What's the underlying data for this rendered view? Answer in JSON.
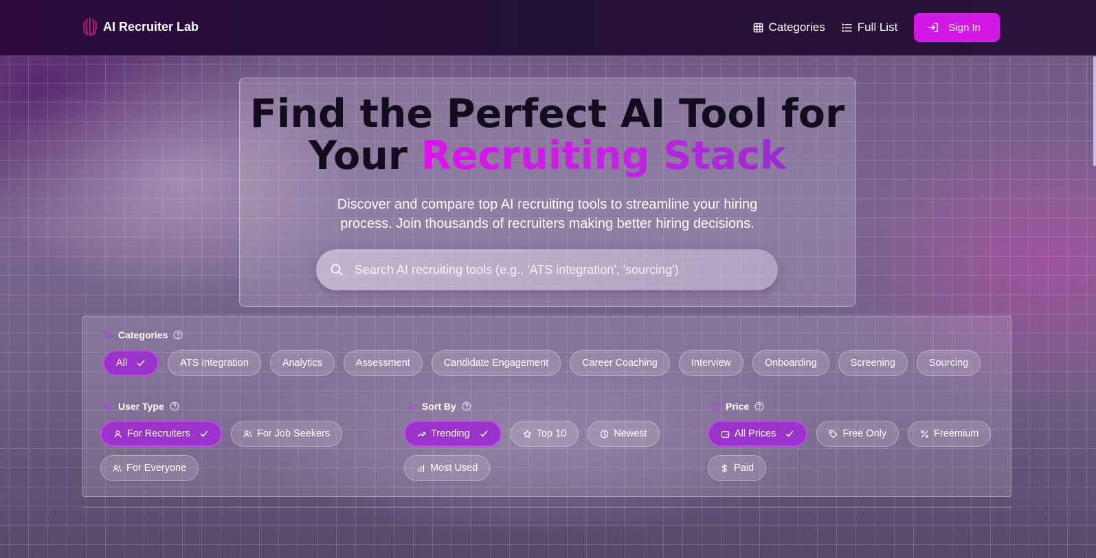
{
  "brand": {
    "name": "AI Recruiter Lab"
  },
  "nav": {
    "links": [
      {
        "label": "Categories",
        "icon": "grid-icon"
      },
      {
        "label": "Full List",
        "icon": "list-icon"
      }
    ],
    "signin_label": "Sign In"
  },
  "hero": {
    "title_line1": "Find the Perfect AI Tool for",
    "title_line2_plain": "Your ",
    "title_line2_accent": "Recruiting Stack",
    "subtitle": "Discover and compare top AI recruiting tools to streamline your hiring process. Join thousands of recruiters making better hiring decisions.",
    "search_placeholder": "Search AI recruiting tools (e.g., 'ATS integration', 'sourcing')"
  },
  "filters": {
    "categories": {
      "label": "Categories",
      "items": [
        "All",
        "ATS Integration",
        "Analytics",
        "Assessment",
        "Candidate Engagement",
        "Career Coaching",
        "Interview",
        "Onboarding",
        "Screening",
        "Sourcing"
      ],
      "active": "All"
    },
    "user_type": {
      "label": "User Type",
      "items": [
        "For Recruiters",
        "For Job Seekers",
        "For Everyone"
      ],
      "active": "For Recruiters"
    },
    "sort_by": {
      "label": "Sort By",
      "items": [
        "Trending",
        "Top 10",
        "Newest",
        "Most Used"
      ],
      "active": "Trending"
    },
    "price": {
      "label": "Price",
      "items": [
        "All Prices",
        "Free Only",
        "Freemium",
        "Paid"
      ],
      "active": "All Prices"
    }
  },
  "colors": {
    "accent": "#d318e6",
    "chip_active": "#9a33c9",
    "nav_bg": "#241236"
  }
}
